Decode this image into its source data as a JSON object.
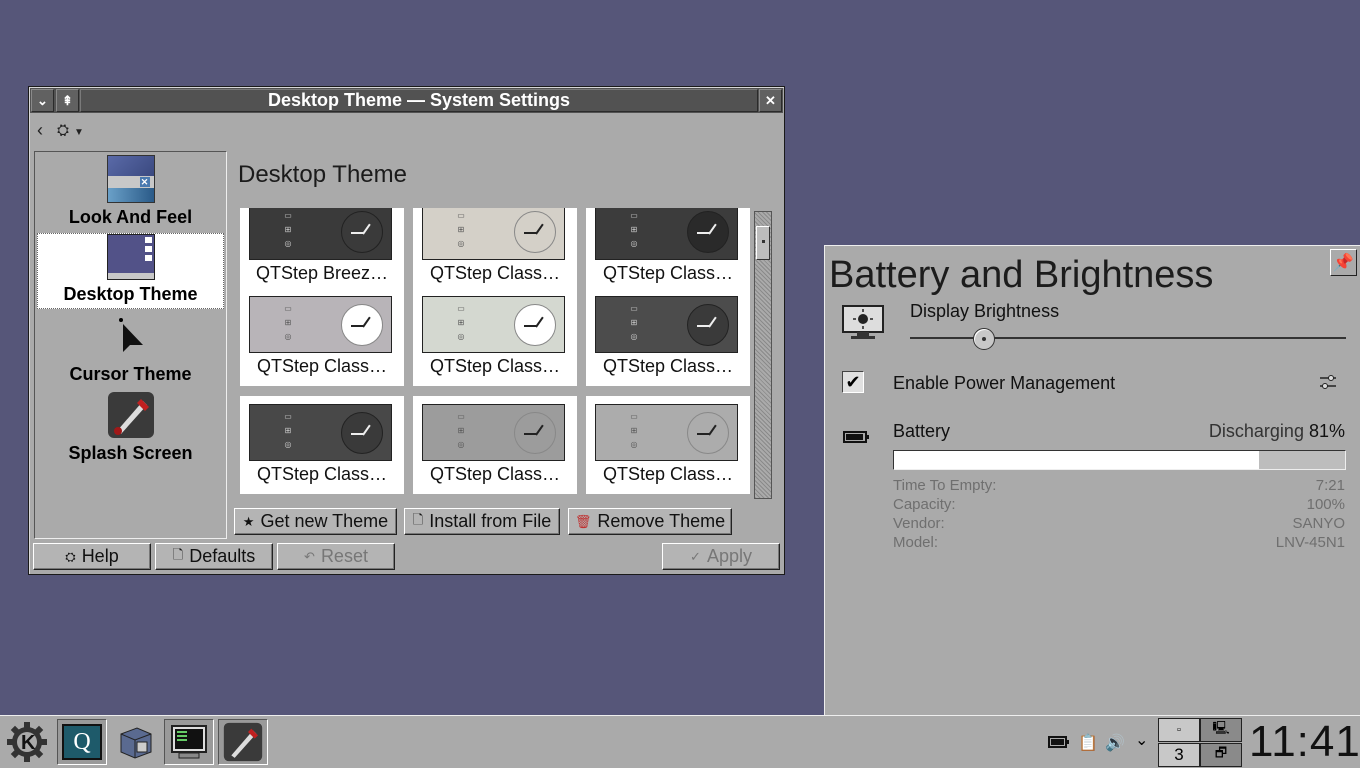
{
  "window": {
    "title": "Desktop Theme — System Settings",
    "heading": "Desktop Theme",
    "sidebar": [
      {
        "label": "Look And Feel",
        "selected": false
      },
      {
        "label": "Desktop Theme",
        "selected": true
      },
      {
        "label": "Cursor Theme",
        "selected": false
      },
      {
        "label": "Splash Screen",
        "selected": false
      }
    ],
    "themes": [
      {
        "label": "QTStep Breez…",
        "bg": "#3a3a3a",
        "clock": "#3a3a3a"
      },
      {
        "label": "QTStep Class…",
        "bg": "#d4d0c8",
        "clock": "#d4d0c8"
      },
      {
        "label": "QTStep Class…",
        "bg": "#3c3c3c",
        "clock": "#2a2a2a"
      },
      {
        "label": "QTStep Class…",
        "bg": "#b8b4b8",
        "clock": "#ffffff"
      },
      {
        "label": "QTStep Class…",
        "bg": "#d4d8d0",
        "clock": "#ffffff"
      },
      {
        "label": "QTStep Class…",
        "bg": "#4c4c4c",
        "clock": "#3a3a3a"
      },
      {
        "label": "QTStep Class…",
        "bg": "#484848",
        "clock": "#3a3a3a"
      },
      {
        "label": "QTStep Class…",
        "bg": "#9c9c9c",
        "clock": "#9c9c9c"
      },
      {
        "label": "QTStep Class…",
        "bg": "#acacac",
        "clock": "#acacac"
      }
    ],
    "buttons": {
      "get_new": "Get new Theme",
      "install": "Install from File",
      "remove": "Remove Theme",
      "help": "Help",
      "defaults": "Defaults",
      "reset": "Reset",
      "apply": "Apply"
    }
  },
  "battery_panel": {
    "title": "Battery and Brightness",
    "brightness_label": "Display Brightness",
    "brightness_level": 0.17,
    "power_mgmt_label": "Enable Power Management",
    "power_mgmt_checked": true,
    "battery_label": "Battery",
    "status": "Discharging",
    "percent": "81%",
    "percent_value": 0.81,
    "details": [
      {
        "key": "Time To Empty:",
        "value": "7:21"
      },
      {
        "key": "Capacity:",
        "value": "100%"
      },
      {
        "key": "Vendor:",
        "value": "SANYO"
      },
      {
        "key": "Model:",
        "value": "LNV-45N1"
      }
    ]
  },
  "taskbar": {
    "clock": "11:41",
    "pager_current": "3"
  }
}
